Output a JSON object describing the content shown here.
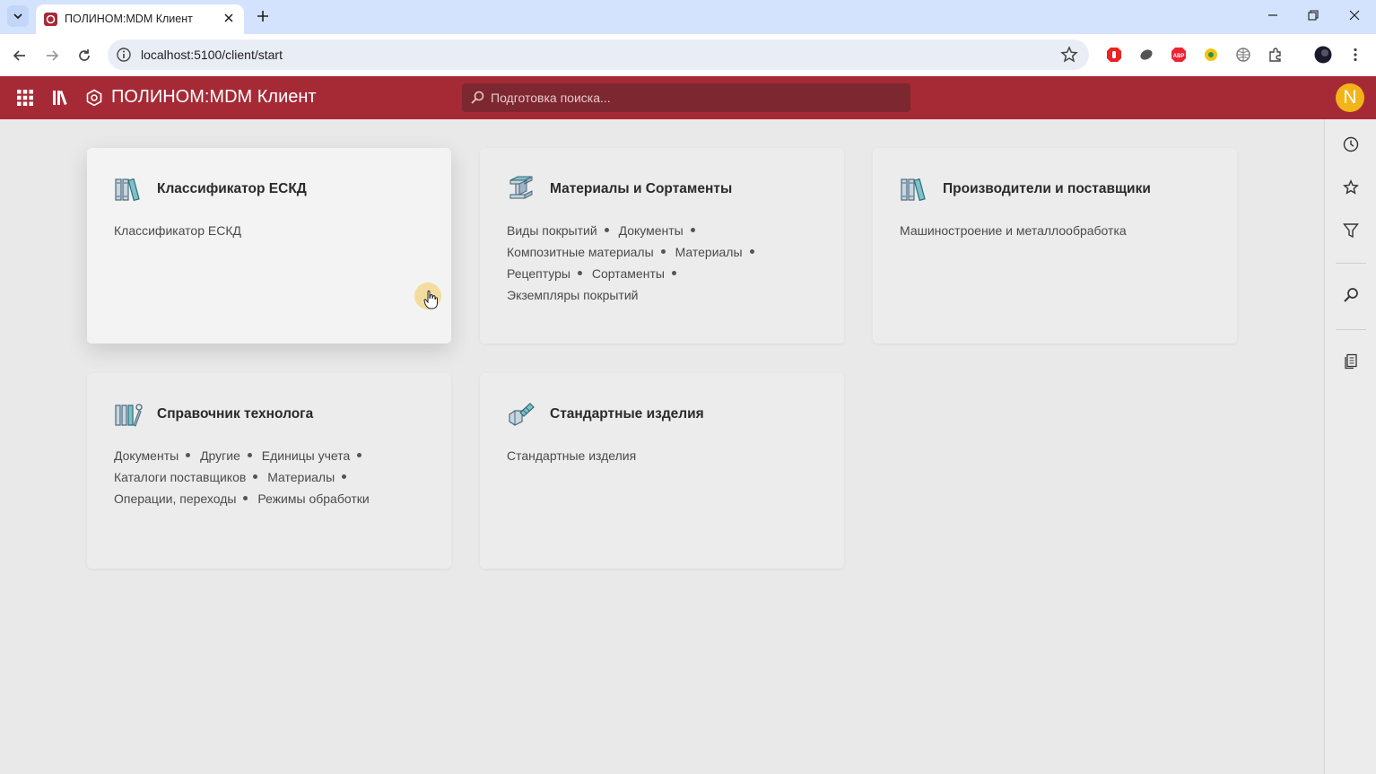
{
  "browser": {
    "tab_title": "ПОЛИНОМ:MDM Клиент",
    "url": "localhost:5100/client/start"
  },
  "app": {
    "title": "ПОЛИНОМ:MDM Клиент",
    "search_placeholder": "Подготовка поиска...",
    "avatar_letter": "N",
    "accent_color": "#a52a36"
  },
  "cards": [
    {
      "title": "Классификатор ЕСКД",
      "icon": "books-icon",
      "links": [
        "Классификатор ЕСКД"
      ]
    },
    {
      "title": "Материалы и Сортаменты",
      "icon": "i-beam-icon",
      "links": [
        "Виды покрытий",
        "Документы",
        "Композитные материалы",
        "Материалы",
        "Рецептуры",
        "Сортаменты",
        "Экземпляры покрытий"
      ]
    },
    {
      "title": "Производители и поставщики",
      "icon": "books-icon",
      "links": [
        "Машиностроение и металлообработка"
      ]
    },
    {
      "title": "Справочник технолога",
      "icon": "books-tools-icon",
      "links": [
        "Документы",
        "Другие",
        "Единицы учета",
        "Каталоги поставщиков",
        "Материалы",
        "Операции, переходы",
        "Режимы обработки"
      ]
    },
    {
      "title": "Стандартные изделия",
      "icon": "bolt-icon",
      "links": [
        "Стандартные изделия"
      ]
    }
  ]
}
